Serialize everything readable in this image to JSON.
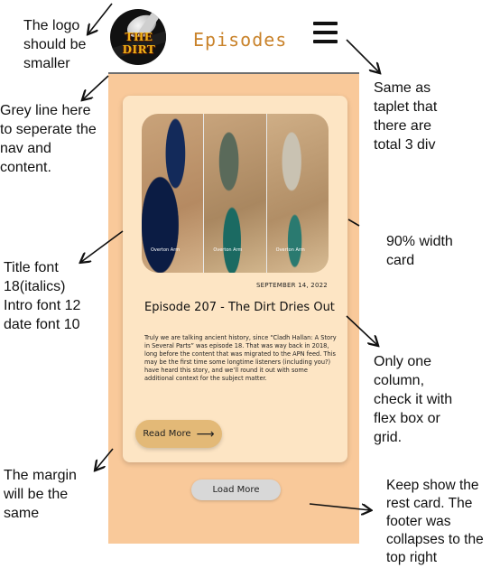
{
  "app": {
    "logo_text": "THE DIRT",
    "title": "Episodes",
    "menu_icon": "hamburger-icon"
  },
  "card": {
    "image_captions": [
      "Overton Arm",
      "Overton Arm",
      "Overton Arm"
    ],
    "date": "SEPTEMBER 14, 2022",
    "title": "Episode 207 - The Dirt Dries Out",
    "intro": "Truly we are talking ancient history, since “Cladh Hallan: A Story in Several Parts” was episode 18. That was way back in 2018, long before the content that was migrated to the APN feed. This may be the first time some longtime listeners (including you?) have heard this story, and we’ll round it out with some additional context for the subject matter.",
    "read_more": "Read More",
    "read_more_icon": "arrow-right-icon"
  },
  "load_more": "Load More",
  "annotations": {
    "logo": "The logo\nshould be\nsmaller",
    "grey_line": "Grey line here\nto seperate the\nnav and\ncontent.",
    "tablet": "Same as\ntaplet that\nthere are\ntotal 3 div",
    "width": "90% width\ncard",
    "fonts": "Title font\n18(italics)\nIntro font 12\ndate font 10",
    "column": "Only one\ncolumn,\ncheck it with\nflex box or\ngrid.",
    "margin": "The margin\nwill be the\nsame",
    "keep_show": "Keep show the\nrest card. The\nfooter was\ncollapses to the\ntop right"
  },
  "colors": {
    "body_bg": "#f9c99a",
    "card_bg": "#fde5c4",
    "title_color": "#c9832b",
    "read_more_bg": "#e3b977",
    "load_more_bg": "#d8d8d8"
  }
}
